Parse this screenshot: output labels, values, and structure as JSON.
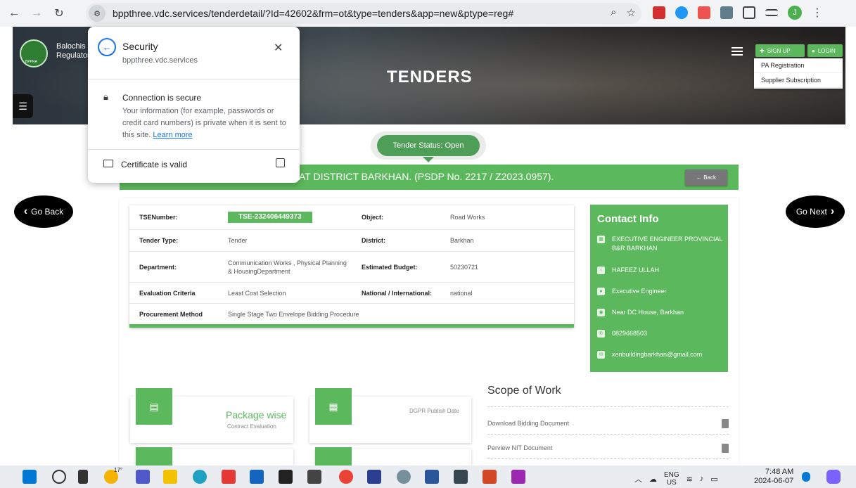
{
  "browser": {
    "url": "bppthree.vdc.services/tenderdetail/?Id=42602&frm=ot&type=tenders&app=new&ptype=reg#",
    "avatar_letter": "J"
  },
  "hero": {
    "org_line1": "Balochis",
    "org_line2": "Regulatory",
    "logo_text": "BPPRA",
    "title": "TENDERS",
    "signup_label": "SIGN UP",
    "login_label": "LOGIN",
    "dropdown_items": [
      "PA Registration",
      "Supplier Subscription"
    ]
  },
  "status": {
    "label": "Tender Status: Open"
  },
  "title_bar": {
    "text": "AT DISTRICT BARKHAN. (PSDP No. 2217 / Z2023.0957).",
    "back_label": "← Back"
  },
  "nav": {
    "go_back": "Go Back",
    "go_next": "Go Next"
  },
  "details": {
    "tse_label": "TSENumber:",
    "tse_value": "TSE-232406449373",
    "object_label": "Object:",
    "object_value": "Road Works",
    "type_label": "Tender Type:",
    "type_value": "Tender",
    "district_label": "District:",
    "district_value": "Barkhan",
    "dept_label": "Department:",
    "dept_value": "Communication Works , Physical Planning & HousingDepartment",
    "budget_label": "Estimated Budget:",
    "budget_value": "50230721",
    "eval_label": "Evaluation Criteria",
    "eval_value": "Least Cost Selection",
    "nat_label": "National / International:",
    "nat_value": "national",
    "proc_label": "Procurement Method",
    "proc_value": "Single Stage Two Envelope Bidding Procedure"
  },
  "contact": {
    "title": "Contact Info",
    "office": "EXECUTIVE ENGINEER PROVINCIAL B&R BARKHAN",
    "person": "HAFEEZ ULLAH",
    "designation": "Executive Engineer",
    "address": "Near DC House, Barkhan",
    "phone": "0829668503",
    "email": "xenbuildingbarkhan@gmail.com"
  },
  "features": {
    "package_title": "Package wise",
    "package_sub": "Contract Evaluation",
    "dgpr_label": "DGPR Publish Date"
  },
  "scope": {
    "title": "Scope of Work",
    "items": [
      "Download Bidding Document",
      "Perview NIT Document"
    ]
  },
  "security_popup": {
    "title": "Security",
    "domain": "bppthree.vdc.services",
    "connection": "Connection is secure",
    "description": "Your information (for example, passwords or credit card numbers) is private when it is sent to this site.",
    "learn_more": "Learn more",
    "certificate": "Certificate is valid"
  },
  "taskbar": {
    "weather": "17°",
    "lang1": "ENG",
    "lang2": "US",
    "time": "7:48 AM",
    "date": "2024-06-07"
  }
}
